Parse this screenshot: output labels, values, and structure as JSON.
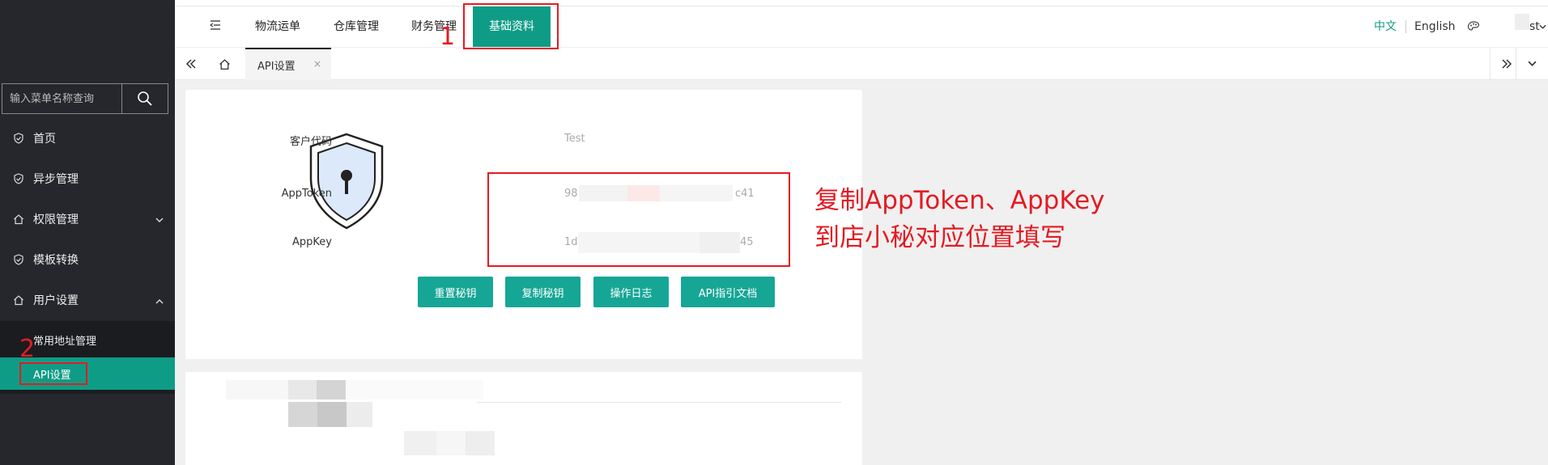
{
  "header": {
    "tabs": [
      {
        "label": "物流运单"
      },
      {
        "label": "仓库管理"
      },
      {
        "label": "财务管理"
      },
      {
        "label": "基础资料"
      }
    ],
    "lang_zh": "中文",
    "lang_en": "English",
    "user_suffix": "st"
  },
  "sidebar": {
    "search_placeholder": "输入菜单名称查询",
    "items": [
      {
        "label": "首页"
      },
      {
        "label": "异步管理"
      },
      {
        "label": "权限管理"
      },
      {
        "label": "模板转换"
      },
      {
        "label": "用户设置"
      }
    ],
    "sub_items": [
      {
        "label": "常用地址管理"
      },
      {
        "label": "API设置"
      }
    ]
  },
  "page_tab": {
    "label": "API设置",
    "close": "×"
  },
  "api": {
    "customer_code_label": "客户代码",
    "customer_code_value": "Test",
    "apptoken_label": "AppToken",
    "apptoken_prefix": "98",
    "apptoken_suffix": "c41",
    "appkey_label": "AppKey",
    "appkey_prefix": "1d",
    "appkey_suffix": "45"
  },
  "buttons": {
    "reset": "重置秘钥",
    "copy": "复制秘钥",
    "log": "操作日志",
    "docs": "API指引文档"
  },
  "annotations": {
    "num1": "1",
    "num2": "2",
    "line1": "复制AppToken、AppKey",
    "line2": "到店小秘对应位置填写"
  },
  "colors": {
    "accent": "#0f9c86",
    "sidebar_bg": "#25272c",
    "annotation": "#e31b23"
  }
}
